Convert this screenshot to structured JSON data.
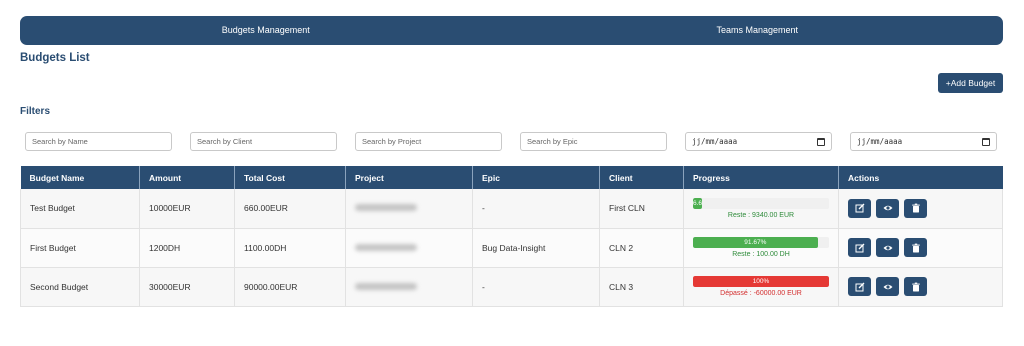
{
  "nav": {
    "tabs": [
      "Budgets Management",
      "Teams Management"
    ]
  },
  "page": {
    "title": "Budgets List",
    "add_button": "+Add Budget",
    "filters_title": "Filters"
  },
  "filters": {
    "name_placeholder": "Search by Name",
    "client_placeholder": "Search by Client",
    "project_placeholder": "Search by Project",
    "epic_placeholder": "Search by Epic",
    "date_format": "jj/mm/aaaa"
  },
  "table": {
    "headers": [
      "Budget Name",
      "Amount",
      "Total Cost",
      "Project",
      "Epic",
      "Client",
      "Progress",
      "Actions"
    ],
    "rows": [
      {
        "name": "Test Budget",
        "amount": "10000EUR",
        "total_cost": "660.00EUR",
        "epic": "-",
        "client": "First CLN",
        "progress_label": "6.6",
        "progress_pct": 6.6,
        "progress_color": "#4caf50",
        "note": "Reste : 9340.00 EUR",
        "note_color": "#2e8b3a"
      },
      {
        "name": "First Budget",
        "amount": "1200DH",
        "total_cost": "1100.00DH",
        "epic": "Bug Data-Insight",
        "client": "CLN 2",
        "progress_label": "91.67%",
        "progress_pct": 91.67,
        "progress_color": "#4caf50",
        "note": "Reste : 100.00 DH",
        "note_color": "#2e8b3a"
      },
      {
        "name": "Second Budget",
        "amount": "30000EUR",
        "total_cost": "90000.00EUR",
        "epic": "-",
        "client": "CLN 3",
        "progress_label": "100%",
        "progress_pct": 100,
        "progress_color": "#e53935",
        "note": "Dépassé : -60000.00 EUR",
        "note_color": "#d32f2f"
      }
    ]
  },
  "icons": {
    "edit": "edit-icon",
    "view": "eye-icon",
    "delete": "trash-icon"
  },
  "colors": {
    "primary": "#2a4d72",
    "success": "#4caf50",
    "danger": "#e53935"
  }
}
